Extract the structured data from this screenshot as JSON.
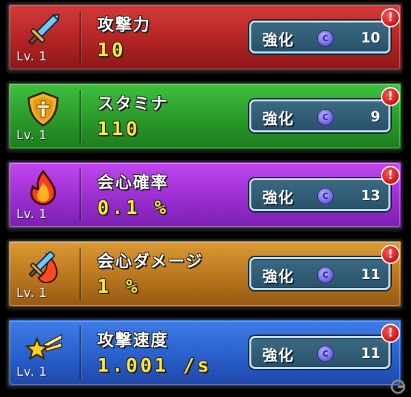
{
  "stats": [
    {
      "name": "攻撃力",
      "value": "10",
      "level": "Lv. 1",
      "button_label": "強化",
      "cost": "10",
      "alert": "!",
      "icon": "sword-icon",
      "color": "#c42d2d"
    },
    {
      "name": "スタミナ",
      "value": "110",
      "level": "Lv. 1",
      "button_label": "強化",
      "cost": "9",
      "alert": "!",
      "icon": "shield-icon",
      "color": "#2fa32f"
    },
    {
      "name": "会心確率",
      "value": "0.1 %",
      "level": "Lv. 1",
      "button_label": "強化",
      "cost": "13",
      "alert": "!",
      "icon": "fire-icon",
      "color": "#a537dd"
    },
    {
      "name": "会心ダメージ",
      "value": "1 %",
      "level": "Lv. 1",
      "button_label": "強化",
      "cost": "11",
      "alert": "!",
      "icon": "flaming-sword-icon",
      "color": "#c2802a"
    },
    {
      "name": "攻撃速度",
      "value": "1.001 /s",
      "level": "Lv. 1",
      "button_label": "強化",
      "cost": "11",
      "alert": "!",
      "icon": "shooting-star-icon",
      "color": "#2f66d6"
    }
  ],
  "coin_symbol": "C",
  "watermark": "gamer-logo-watermark"
}
